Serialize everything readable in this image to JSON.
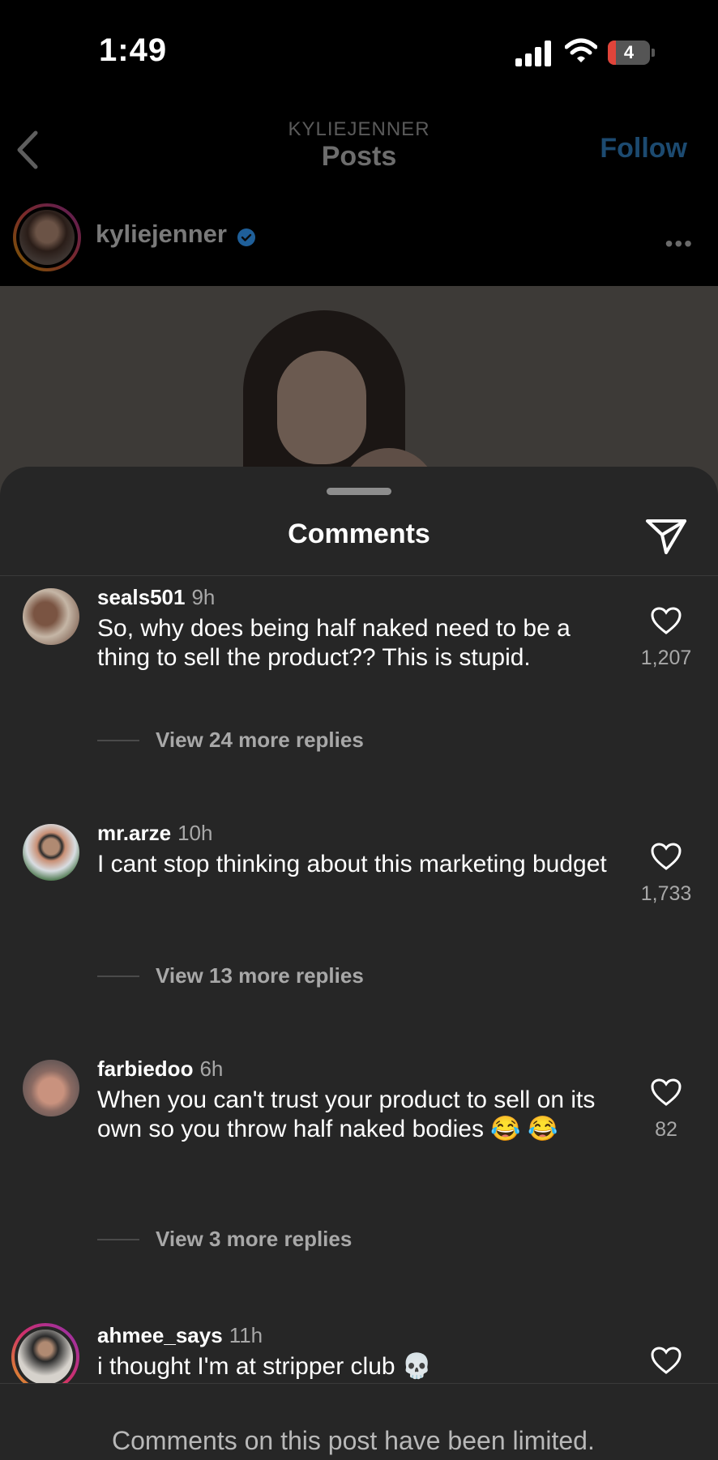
{
  "status_bar": {
    "time": "1:49",
    "battery_level": "4"
  },
  "nav": {
    "subtitle": "KYLIEJENNER",
    "title": "Posts",
    "follow_label": "Follow"
  },
  "post": {
    "username": "kyliejenner",
    "more_label": "•••"
  },
  "sheet": {
    "title": "Comments"
  },
  "comments": [
    {
      "user": "seals501",
      "time": "9h",
      "text": "So,  why does being half naked need to be a thing to sell the product?? This is stupid.",
      "likes": "1,207",
      "replies_label": "View 24 more replies"
    },
    {
      "user": "mr.arze",
      "time": "10h",
      "text": "I cant stop thinking about this marketing budget",
      "likes": "1,733",
      "replies_label": "View 13 more replies"
    },
    {
      "user": "farbiedoo",
      "time": "6h",
      "text": "When you can't trust your product to sell on its own so you throw half naked bodies 😂 😂",
      "likes": "82",
      "replies_label": "View 3 more replies"
    },
    {
      "user": "ahmee_says",
      "time": "11h",
      "text": "i thought I'm at stripper club 💀",
      "likes": ""
    }
  ],
  "footer": {
    "limited_text": "Comments on this post have been limited."
  },
  "colors": {
    "sheet_bg": "#262626",
    "follow_blue": "#1c4a70",
    "secondary_text": "#a8a8a8"
  },
  "icons": [
    "back-chevron-icon",
    "signal-icon",
    "wifi-icon",
    "battery-icon",
    "verified-badge-icon",
    "share-icon",
    "heart-icon"
  ]
}
